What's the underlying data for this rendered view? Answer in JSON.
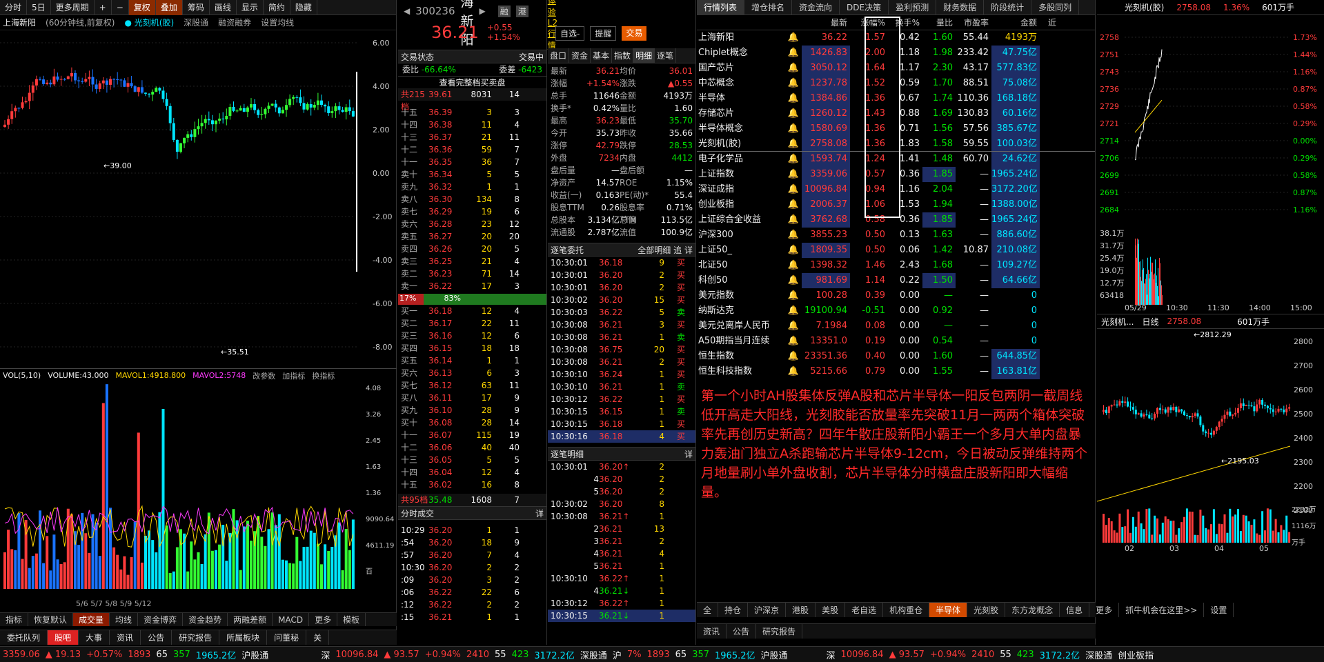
{
  "left": {
    "toolbar": [
      "分时",
      "5日",
      "更多周期",
      "+",
      "−",
      "复权",
      "叠加",
      "筹码",
      "画线",
      "显示",
      "简约",
      "隐藏"
    ],
    "stock_name": "上海新阳",
    "chart_label": "(60分钟线,前复权)",
    "overlay": "光刻机(胶)",
    "extras": [
      "深股通",
      "融资融券",
      "设置均线"
    ],
    "axis_labels": [
      "6.00",
      "4.00",
      "2.00",
      "0.00",
      "-2.00",
      "-4.00",
      "-6.00",
      "-8.00"
    ],
    "annotations": {
      "high": "39.00",
      "low": "35.51"
    },
    "vol_bar": {
      "label": "VOL(5,10)",
      "volume": "VOLUME:43.000",
      "ma1": "MAVOL1:4918.800",
      "ma2": "MAVOL2:5748",
      "btns": [
        "改参数",
        "加指标",
        "换指标"
      ]
    },
    "vol_axis": [
      "4.08",
      "3.26",
      "2.45",
      "1.63",
      "1.36",
      "9090.64",
      "4611.19",
      "百"
    ],
    "date_labels": "5/6 5/7 5/8 5/9 5/12",
    "tabs": [
      "指标",
      "恢复默认",
      "成交量",
      "均线",
      "资金博弈",
      "资金趋势",
      "两融差额",
      "MACD",
      "更多",
      "模板"
    ],
    "tabs2": [
      "委托队列",
      "股吧",
      "大事",
      "资讯",
      "公告",
      "研究报告",
      "所属板块",
      "问董秘",
      "关"
    ]
  },
  "quote": {
    "code": "300236",
    "name": "上海新阳",
    "tags": [
      "融",
      "港"
    ],
    "l2_link": "免费体验L2行情",
    "price": "36.21",
    "change": "+0.55",
    "pct": "+1.54%",
    "btns": [
      "自选-",
      "提醒",
      "交易"
    ],
    "status_label": "交易状态",
    "status_value": "交易中",
    "ratio": {
      "label1": "委比",
      "val1": "-66.64%",
      "label2": "委差",
      "val2": "-6423"
    },
    "full_book": "查看完整档买卖盘",
    "ask_summary": {
      "label": "共215档",
      "price": "39.61",
      "vol": "8031",
      "count": "14"
    },
    "asks": [
      [
        "十五",
        "36.39",
        "3",
        "3"
      ],
      [
        "十四",
        "36.38",
        "11",
        "4"
      ],
      [
        "十三",
        "36.37",
        "21",
        "11"
      ],
      [
        "十二",
        "36.36",
        "59",
        "7"
      ],
      [
        "十一",
        "36.35",
        "36",
        "7"
      ],
      [
        "卖十",
        "36.34",
        "5",
        "5"
      ],
      [
        "卖九",
        "36.32",
        "1",
        "1"
      ],
      [
        "卖八",
        "36.30",
        "134",
        "8"
      ],
      [
        "卖七",
        "36.29",
        "19",
        "6"
      ],
      [
        "卖六",
        "36.28",
        "23",
        "12"
      ],
      [
        "卖五",
        "36.27",
        "20",
        "20"
      ],
      [
        "卖四",
        "36.26",
        "20",
        "5"
      ],
      [
        "卖三",
        "36.25",
        "21",
        "4"
      ],
      [
        "卖二",
        "36.23",
        "71",
        "14"
      ],
      [
        "卖一",
        "36.22",
        "17",
        "3"
      ]
    ],
    "mid_bar": {
      "left": "17%",
      "right": "83%"
    },
    "bids": [
      [
        "买一",
        "36.18",
        "12",
        "4"
      ],
      [
        "买二",
        "36.17",
        "22",
        "11"
      ],
      [
        "买三",
        "36.16",
        "12",
        "6"
      ],
      [
        "买四",
        "36.15",
        "18",
        "18"
      ],
      [
        "买五",
        "36.14",
        "1",
        "1"
      ],
      [
        "买六",
        "36.13",
        "6",
        "3"
      ],
      [
        "买七",
        "36.12",
        "63",
        "11"
      ],
      [
        "买八",
        "36.11",
        "17",
        "9"
      ],
      [
        "买九",
        "36.10",
        "28",
        "9"
      ],
      [
        "买十",
        "36.08",
        "28",
        "14"
      ],
      [
        "十一",
        "36.07",
        "115",
        "19"
      ],
      [
        "十二",
        "36.06",
        "40",
        "40"
      ],
      [
        "十三",
        "36.05",
        "5",
        "5"
      ],
      [
        "十四",
        "36.04",
        "12",
        "4"
      ],
      [
        "十五",
        "36.02",
        "16",
        "8"
      ]
    ],
    "bid_summary": {
      "label": "共95档",
      "price": "35.48",
      "vol": "1608",
      "count": "7"
    },
    "tick_title": "分时成交",
    "tick_btn": "详",
    "ticks": [
      [
        "10:29",
        "36.20",
        "1",
        "1"
      ],
      [
        ":54",
        "36.20",
        "18",
        "9"
      ],
      [
        ":57",
        "36.20",
        "7",
        "4"
      ],
      [
        "10:30",
        "36.20",
        "2",
        "2"
      ],
      [
        ":09",
        "36.20",
        "3",
        "2"
      ],
      [
        ":06",
        "36.22",
        "22",
        "6"
      ],
      [
        ":12",
        "36.22",
        "2",
        "2"
      ],
      [
        ":15",
        "36.21",
        "1",
        "1"
      ]
    ]
  },
  "detail": {
    "tabs": [
      "盘口",
      "资金",
      "基本",
      "指数",
      "明细",
      "逐笔"
    ],
    "kv": [
      [
        "最新",
        "36.21",
        "均价",
        "36.01"
      ],
      [
        "涨幅",
        "+1.54%",
        "涨跌",
        "▲0.55"
      ],
      [
        "总手",
        "11646",
        "金额",
        "4193万"
      ],
      [
        "换手*",
        "0.42%",
        "量比",
        "1.60"
      ],
      [
        "最高",
        "36.23",
        "最低",
        "35.70"
      ],
      [
        "今开",
        "35.73",
        "昨收",
        "35.66"
      ],
      [
        "涨停",
        "42.79",
        "跌停",
        "28.53"
      ],
      [
        "外盘",
        "7234",
        "内盘",
        "4412"
      ],
      [
        "盘后量",
        "—",
        "盘后额",
        "—"
      ],
      [
        "净资产",
        "14.57",
        "ROE",
        "1.15%"
      ],
      [
        "收益(一)",
        "0.163",
        "PE(动)*",
        "55.4"
      ],
      [
        "股息TTM",
        "0.26",
        "股息率TTM",
        "0.71%"
      ],
      [
        "总股本",
        "3.134亿",
        "总值",
        "113.5亿"
      ],
      [
        "流通股",
        "2.787亿",
        "流值",
        "100.9亿"
      ]
    ],
    "zhubi_title": "逐笔委托",
    "zhubi_btns": [
      "全部明细",
      "追",
      "详"
    ],
    "zhubi": [
      [
        "10:30:01",
        "36.18",
        "9",
        "买"
      ],
      [
        "10:30:01",
        "36.20",
        "2",
        "买"
      ],
      [
        "10:30:01",
        "36.20",
        "2",
        "买"
      ],
      [
        "10:30:02",
        "36.20",
        "15",
        "买"
      ],
      [
        "10:30:03",
        "36.22",
        "5",
        "卖"
      ],
      [
        "10:30:08",
        "36.21",
        "3",
        "买"
      ],
      [
        "10:30:08",
        "36.21",
        "1",
        "卖"
      ],
      [
        "10:30:08",
        "36.75",
        "20",
        "买"
      ],
      [
        "10:30:08",
        "36.21",
        "2",
        "买"
      ],
      [
        "10:30:10",
        "36.24",
        "1",
        "买"
      ],
      [
        "10:30:10",
        "36.21",
        "1",
        "卖"
      ],
      [
        "10:30:12",
        "36.22",
        "1",
        "买"
      ],
      [
        "10:30:15",
        "36.15",
        "1",
        "卖"
      ],
      [
        "10:30:15",
        "36.18",
        "1",
        "买"
      ],
      [
        "10:30:16",
        "36.18",
        "4",
        "买"
      ]
    ],
    "mingxi_title": "逐笔明细",
    "mingxi_btn": "详",
    "mingxi": [
      [
        "10:30:01",
        "36.20↑",
        "2"
      ],
      [
        "4",
        "36.20",
        "2"
      ],
      [
        "5",
        "36.20",
        "2"
      ],
      [
        "10:30:02",
        "36.20",
        "8"
      ],
      [
        "10:30:08",
        "36.21↑",
        "1"
      ],
      [
        "2",
        "36.21",
        "13"
      ],
      [
        "3",
        "36.21",
        "2"
      ],
      [
        "4",
        "36.21",
        "4"
      ],
      [
        "5",
        "36.21",
        "1"
      ],
      [
        "10:30:10",
        "36.22↑",
        "1"
      ],
      [
        "4",
        "36.21↓",
        "1"
      ],
      [
        "10:30:12",
        "36.22↑",
        "1"
      ],
      [
        "10:30:15",
        "36.21↓",
        "1"
      ]
    ]
  },
  "watch": {
    "tabs": [
      "行情列表",
      "增仓排名",
      "资金流向",
      "DDE决策",
      "盈利预测",
      "财务数据",
      "阶段统计",
      "多股同列"
    ],
    "headers": [
      "",
      "",
      "最新",
      "涨幅%",
      "换手%",
      "量比",
      "市盈率",
      "金额",
      "近"
    ],
    "rows": [
      [
        "上海新阳",
        "36.22",
        "1.57",
        "0.42",
        "1.60",
        "55.44",
        "4193万",
        "r",
        false
      ],
      [
        "Chiplet概念",
        "1426.83",
        "2.00",
        "1.18",
        "1.98",
        "233.42",
        "47.75亿",
        "r",
        true
      ],
      [
        "国产芯片",
        "3050.12",
        "1.64",
        "1.17",
        "2.30",
        "43.17",
        "577.83亿",
        "r",
        true
      ],
      [
        "中芯概念",
        "1237.78",
        "1.52",
        "0.59",
        "1.70",
        "88.51",
        "75.08亿",
        "r",
        true
      ],
      [
        "半导体",
        "1384.86",
        "1.36",
        "0.67",
        "1.74",
        "110.36",
        "168.18亿",
        "r",
        true
      ],
      [
        "存储芯片",
        "1260.12",
        "1.43",
        "0.88",
        "1.69",
        "130.83",
        "60.16亿",
        "r",
        true
      ],
      [
        "半导体概念",
        "1580.69",
        "1.36",
        "0.71",
        "1.56",
        "57.56",
        "385.67亿",
        "r",
        true
      ],
      [
        "光刻机(胶)",
        "2758.08",
        "1.36",
        "1.83",
        "1.58",
        "59.55",
        "100.03亿",
        "r",
        true
      ],
      [
        "电子化学品",
        "1593.74",
        "1.24",
        "1.41",
        "1.48",
        "60.70",
        "24.62亿",
        "r",
        true
      ],
      [
        "上证指数",
        "3359.06",
        "0.57",
        "0.36",
        "1.85",
        "—",
        "1965.24亿",
        "r",
        true
      ],
      [
        "深证成指",
        "10096.84",
        "0.94",
        "1.16",
        "2.04",
        "—",
        "3172.20亿",
        "r",
        true
      ],
      [
        "创业板指",
        "2006.37",
        "1.06",
        "1.53",
        "1.94",
        "—",
        "1388.00亿",
        "r",
        true
      ],
      [
        "上证综合全收益",
        "3762.68",
        "0.58",
        "0.36",
        "1.85",
        "—",
        "1965.24亿",
        "r",
        true
      ],
      [
        "沪深300",
        "3855.23",
        "0.50",
        "0.13",
        "1.63",
        "—",
        "886.60亿",
        "r",
        false
      ],
      [
        "上证50_",
        "1809.35",
        "0.50",
        "0.06",
        "1.42",
        "10.87",
        "210.08亿",
        "r",
        true
      ],
      [
        "北证50",
        "1398.32",
        "1.46",
        "2.43",
        "1.68",
        "—",
        "109.27亿",
        "r",
        false
      ],
      [
        "科创50",
        "981.69",
        "1.14",
        "0.22",
        "1.50",
        "—",
        "64.66亿",
        "r",
        true
      ],
      [
        "美元指数",
        "100.28",
        "0.39",
        "0.00",
        "—",
        "—",
        "0",
        "r",
        false
      ],
      [
        "纳斯达克",
        "19100.94",
        "-0.51",
        "0.00",
        "0.92",
        "—",
        "0",
        "g",
        false
      ],
      [
        "美元兑离岸人民币",
        "7.1984",
        "0.08",
        "0.00",
        "—",
        "—",
        "0",
        "r",
        false
      ],
      [
        "A50期指当月连续",
        "13351.0",
        "0.19",
        "0.00",
        "0.54",
        "—",
        "0",
        "r",
        false
      ],
      [
        "恒生指数",
        "23351.36",
        "0.40",
        "0.00",
        "1.60",
        "—",
        "644.85亿",
        "r",
        false
      ],
      [
        "恒生科技指数",
        "5215.66",
        "0.79",
        "0.00",
        "1.55",
        "—",
        "163.81亿",
        "r",
        false
      ]
    ],
    "note": "第一个小时AH股集体反弹A股和芯片半导体一阳反包两阴一截周线低开高走大阳线，光刻胶能否放量率先突破11月一两两个箱体突破率先再创历史新高？四年牛散庄股新阳小霸王一个多月大单内盘暴力轰油门独立A杀跑输芯片半导体9-12cm，今日被动反弹维持两个月地量刷小单外盘收割，芯片半导体分时横盘庄股新阳即大幅缩量。",
    "bottom_tabs": [
      "全",
      "持仓",
      "沪深京",
      "港股",
      "美股",
      "老自选",
      "机构重仓",
      "半导体",
      "光刻胶",
      "东方龙概念",
      "信息",
      "更多"
    ],
    "promo": "抓牛机会在这里>>",
    "settings": "设置",
    "bottom_tabs2": [
      "资讯",
      "公告",
      "研究报告"
    ]
  },
  "right": {
    "mini_title": "光刻机(胶)",
    "mini_price": "2758.08",
    "mini_pct": "1.36%",
    "mini_vol": "601万手",
    "mini_axis": [
      "2758",
      "2751",
      "2743",
      "2736",
      "2729",
      "2721",
      "2714",
      "2706",
      "2699",
      "2691",
      "2684"
    ],
    "mini_pct_axis": [
      "1.73%",
      "1.44%",
      "1.16%",
      "0.87%",
      "0.58%",
      "0.29%",
      "0.00%",
      "0.29%",
      "0.58%",
      "0.87%",
      "1.16%"
    ],
    "mini_vol_axis": [
      "38.1万",
      "31.7万",
      "25.4万",
      "19.0万",
      "12.7万",
      "63418"
    ],
    "mini_times": [
      "05/29",
      "10:30",
      "11:30",
      "14:00",
      "15:00"
    ],
    "day_title": "光刻机...",
    "day_label": "日线",
    "day_price": "2758.08",
    "day_vol": "601万手",
    "day_axis": [
      "2800",
      "2700",
      "2600",
      "2500",
      "2400",
      "2300",
      "2200",
      "2100"
    ],
    "day_annot_high": "2812.29",
    "day_annot_low": "2195.03",
    "day_vol_axis": [
      "2232万",
      "1116万",
      "万手"
    ],
    "day_months": [
      "02",
      "03",
      "04",
      "05"
    ]
  },
  "status": {
    "sh_idx": "3359.06",
    "sh_chg": "▲ 19.13",
    "sh_pct": "+0.57%",
    "sh_up": "1893",
    "sh_flat": "65",
    "sh_down": "357",
    "sh_amt": "1965.2亿",
    "sh_conn": "沪股通",
    "sz_label": "深",
    "sz_idx": "10096.84",
    "sz_chg": "▲ 93.57",
    "sz_pct": "+0.94%",
    "sz_up": "2410",
    "sz_flat": "55",
    "sz_down": "423",
    "sz_amt": "3172.2亿",
    "sz_conn": "深股通",
    "sh_label2": "沪",
    "sh_pct2": "7%",
    "cyb": "创业板指"
  }
}
